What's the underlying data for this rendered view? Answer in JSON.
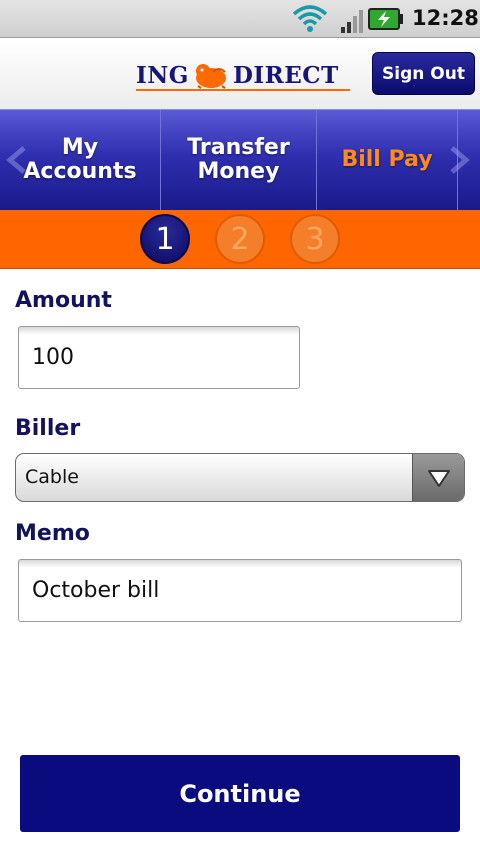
{
  "status_bar": {
    "time": "12:28",
    "icons": [
      "wifi-icon",
      "signal-icon",
      "battery-charging-icon"
    ]
  },
  "header": {
    "logo_left": "ING",
    "logo_right": "DIRECT",
    "logo_icon": "lion-icon",
    "sign_out_label": "Sign Out"
  },
  "nav": {
    "tabs": [
      {
        "line1": "My",
        "line2": "Accounts",
        "active": false
      },
      {
        "line1": "Transfer",
        "line2": "Money",
        "active": false
      },
      {
        "line1": "Bill Pay",
        "line2": "",
        "active": true
      }
    ],
    "icons": [
      "chevron-left-icon",
      "chevron-right-icon"
    ]
  },
  "steps": {
    "items": [
      "1",
      "2",
      "3"
    ],
    "current": 1
  },
  "form": {
    "amount_label": "Amount",
    "amount_value": "100",
    "biller_label": "Biller",
    "biller_value": "Cable",
    "memo_label": "Memo",
    "memo_value": "October bill"
  },
  "continue_label": "Continue",
  "colors": {
    "brand_blue": "#0b0b80",
    "brand_orange": "#ff6600",
    "label_color": "#12125e"
  }
}
